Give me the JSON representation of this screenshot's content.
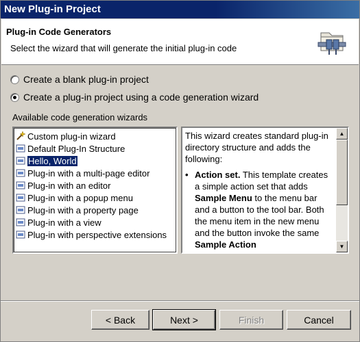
{
  "window": {
    "title": "New Plug-in Project"
  },
  "header": {
    "title": "Plug-in Code Generators",
    "description": "Select the wizard that will generate the initial plug-in code",
    "icon": "plugin-wizard-icon"
  },
  "options": [
    {
      "label": "Create a blank plug-in project",
      "checked": false
    },
    {
      "label": "Create a plug-in project using a code generation wizard",
      "checked": true
    }
  ],
  "wizards": {
    "label": "Available code generation wizards",
    "selected": "Hello, World",
    "items": [
      "Custom plug-in wizard",
      "Default Plug-In Structure",
      "Hello, World",
      "Plug-in with a multi-page editor",
      "Plug-in with an editor",
      "Plug-in with a popup menu",
      "Plug-in with a property page",
      "Plug-in with a view",
      "Plug-in with perspective extensions"
    ]
  },
  "description_panel": {
    "intro": "This wizard creates standard plug-in directory structure and adds the following:",
    "bullet_title": "Action set.",
    "bullet_text_1": " This template creates a simple action set that adds ",
    "bullet_bold_1": "Sample Menu",
    "bullet_text_2": " to the menu bar and a button to the tool bar. Both the menu item in the new menu and the button invoke the same ",
    "bullet_bold_2": "Sample Action"
  },
  "buttons": {
    "back": "< Back",
    "next": "Next >",
    "finish": "Finish",
    "cancel": "Cancel"
  },
  "colors": {
    "title_bar": "#0a246a",
    "selection": "#0a246a",
    "dialog_bg": "#d4d0c8"
  }
}
